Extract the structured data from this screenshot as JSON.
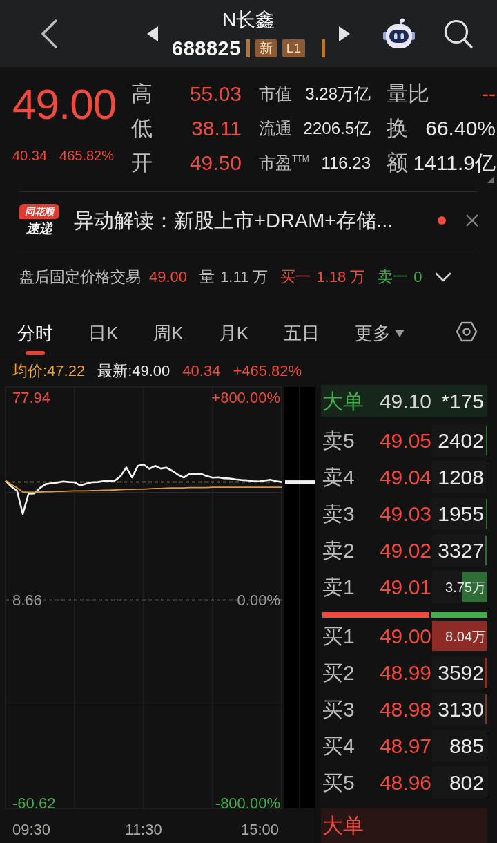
{
  "header": {
    "title": "N长鑫",
    "code": "688825",
    "badges": [
      "新",
      "L1"
    ]
  },
  "quote": {
    "price": "49.00",
    "change": "40.34",
    "change_pct": "465.82%",
    "stats": [
      {
        "label": "高",
        "value": "55.03"
      },
      {
        "label": "低",
        "value": "38.11"
      },
      {
        "label": "开",
        "value": "49.50"
      }
    ],
    "fundamentals": [
      {
        "label": "市值",
        "value": "3.28万亿"
      },
      {
        "label": "流通",
        "value": "2206.5亿"
      },
      {
        "label": "市盈$^{TTM}$",
        "value": "116.23"
      }
    ],
    "ratios": [
      {
        "label": "量比",
        "value": "--",
        "color": "#f0493e"
      },
      {
        "label": "换",
        "value": "66.40%",
        "color": "#e8e8e8"
      },
      {
        "label": "额",
        "value": "1411.9亿",
        "color": "#e8e8e8"
      }
    ]
  },
  "news": {
    "logo_top": "同花顺",
    "logo_bottom": "速递",
    "text": "异动解读：新股上市+DRAM+存储...",
    "unread": true
  },
  "after_hours": {
    "label": "盘后固定价格交易",
    "price": "49.00",
    "volume_label": "量",
    "volume": "1.11 万",
    "bid_label": "买一",
    "bid": "1.18 万",
    "ask_label": "卖一",
    "ask": "0",
    "expanded": false
  },
  "tabs": [
    {
      "label": "分时",
      "selected": true,
      "has_menu": false
    },
    {
      "label": "日K",
      "selected": false,
      "has_menu": false
    },
    {
      "label": "周K",
      "selected": false,
      "has_menu": false
    },
    {
      "label": "月K",
      "selected": false,
      "has_menu": false
    },
    {
      "label": "五日",
      "selected": false,
      "has_menu": false
    },
    {
      "label": "更多",
      "selected": false,
      "has_menu": true
    }
  ],
  "legend": {
    "avg": "均价:47.22",
    "latest": "最新:49.00",
    "change": "40.34",
    "change_pct": "+465.82%"
  },
  "chart": {
    "percent_ticks": [
      "+800.00%",
      "0.00%",
      "-800.00%"
    ],
    "time_labels": [
      "09:30",
      "11:30",
      "15:00"
    ],
    "chart_data": {
      "type": "line",
      "grid": true,
      "series": [
        {
          "color": "#f2f2f2",
          "values": [
            49.5,
            47.5,
            46.0,
            38.1,
            45.0,
            45.1,
            47.0,
            48.3,
            48.6,
            48.8,
            49.2,
            49.0,
            48.9,
            47.8,
            48.4,
            48.9,
            49.0,
            49.3,
            49.3,
            49.5,
            51.0,
            54.0,
            50.6,
            54.5,
            55.0,
            53.5,
            54.5,
            53.6,
            53.9,
            52.8,
            51.5,
            50.5,
            51.8,
            51.7,
            51.8,
            51.0,
            50.5,
            50.6,
            50.3,
            50.2,
            49.9,
            49.7,
            49.6,
            49.3,
            49.2,
            49.5,
            49.8,
            49.3,
            49.0
          ]
        },
        {
          "color": "#e09a30",
          "values": [
            49.5,
            48.2,
            47.0,
            45.6,
            45.5,
            45.5,
            45.6,
            45.7,
            45.7,
            45.8,
            45.8,
            45.9,
            46.0,
            46.0,
            46.0,
            46.1,
            46.1,
            46.2,
            46.2,
            46.3,
            46.4,
            46.5,
            46.5,
            46.6,
            46.6,
            46.7,
            46.8,
            46.8,
            46.9,
            47.0,
            47.0,
            47.0,
            47.1,
            47.1,
            47.1,
            47.1,
            47.2,
            47.2,
            47.2,
            47.2,
            47.2,
            47.2,
            47.2,
            47.2,
            47.2,
            47.2,
            47.2,
            47.2,
            47.2
          ]
        }
      ],
      "ylim": [
        -62.51,
        81.48
      ],
      "yticks": [
        {
          "value": 77.94,
          "label": "77.94"
        },
        {
          "value": 8.66,
          "label": "8.66"
        },
        {
          "value": -60.62,
          "label": "-60.62"
        }
      ],
      "ref_lines": [
        {
          "axis": "y",
          "value": 8.66,
          "color": "#8a8a8a"
        },
        {
          "axis": "y",
          "value": 49.0,
          "color": "#c9a46a"
        }
      ]
    }
  },
  "order_book": {
    "big_orders": [
      {
        "kind": "sell",
        "label": "大单",
        "price": "49.10",
        "volume": "*175"
      },
      {
        "kind": "buy",
        "label": "大单"
      }
    ],
    "asks": [
      {
        "label": "卖5",
        "price": "49.05",
        "volume": "2402",
        "compact": false,
        "level": 0.03
      },
      {
        "label": "卖4",
        "price": "49.04",
        "volume": "1208",
        "compact": false,
        "level": 0.015
      },
      {
        "label": "卖3",
        "price": "49.03",
        "volume": "1955",
        "compact": false,
        "level": 0.024
      },
      {
        "label": "卖2",
        "price": "49.02",
        "volume": "3327",
        "compact": false,
        "level": 0.041
      },
      {
        "label": "卖1",
        "price": "49.01",
        "volume": "3.75万",
        "compact": true,
        "level": 0.466
      }
    ],
    "ratio": {
      "level": 0.66
    },
    "bids": [
      {
        "label": "买1",
        "price": "49.00",
        "volume": "8.04万",
        "compact": true,
        "level": 1.0
      },
      {
        "label": "买2",
        "price": "48.99",
        "volume": "3592",
        "compact": false,
        "level": 0.045
      },
      {
        "label": "买3",
        "price": "48.98",
        "volume": "3130",
        "compact": false,
        "level": 0.039
      },
      {
        "label": "买4",
        "price": "48.97",
        "volume": "885",
        "compact": false,
        "level": 0.011
      },
      {
        "label": "买5",
        "price": "48.96",
        "volume": "802",
        "compact": false,
        "level": 0.01
      }
    ]
  }
}
